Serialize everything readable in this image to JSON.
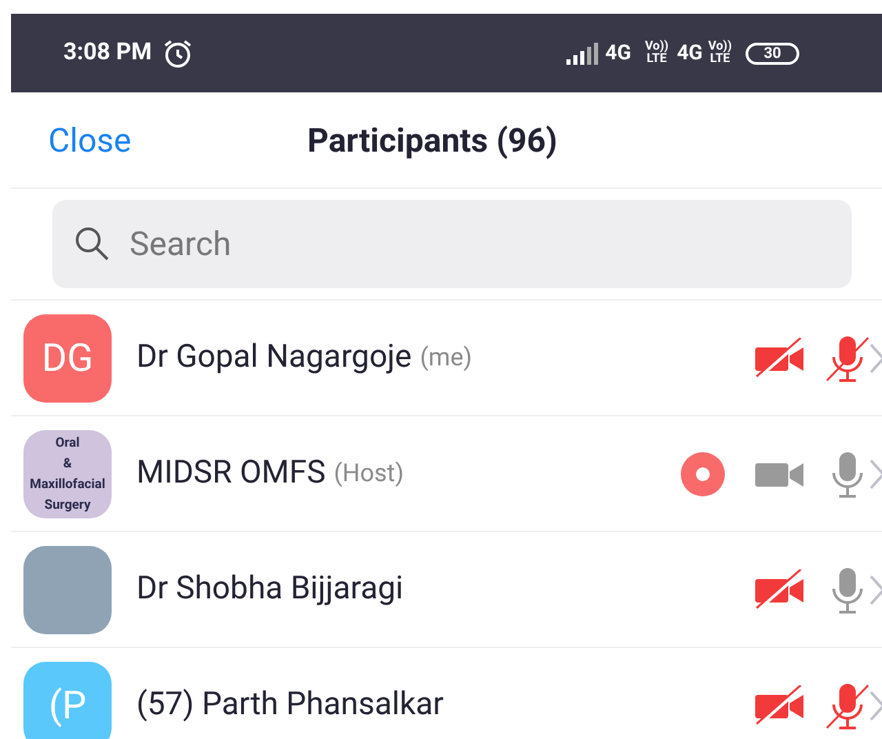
{
  "status_bar": {
    "time": "3:08 PM",
    "network_1": "4G",
    "volte_1": [
      "Vo))",
      "LTE"
    ],
    "network_2": "4G",
    "volte_2": [
      "Vo))",
      "LTE"
    ],
    "battery": "30"
  },
  "header": {
    "close": "Close",
    "title": "Participants (96)"
  },
  "search": {
    "placeholder": "Search"
  },
  "participants": [
    {
      "avatar": {
        "kind": "initials",
        "text": "DG",
        "color": "#f96a6b"
      },
      "name": "Dr Gopal Nagargoje",
      "role": "(me)",
      "recording": false,
      "video_on": false,
      "mic_on": false
    },
    {
      "avatar": {
        "kind": "logo",
        "lines": [
          "Oral",
          "&",
          "Maxillofacial",
          "Surgery"
        ],
        "color": "#cfc3de"
      },
      "name": "MIDSR OMFS",
      "role": "(Host)",
      "recording": true,
      "video_on": true,
      "mic_on": true
    },
    {
      "avatar": {
        "kind": "photo"
      },
      "name": "Dr Shobha Bijjaragi",
      "recording": false,
      "video_on": false,
      "mic_on": true
    },
    {
      "avatar": {
        "kind": "initials",
        "text": "(P",
        "color": "#5ac8fa"
      },
      "name": "(57) Parth Phansalkar",
      "recording": false,
      "video_on": false,
      "mic_on": false
    }
  ]
}
